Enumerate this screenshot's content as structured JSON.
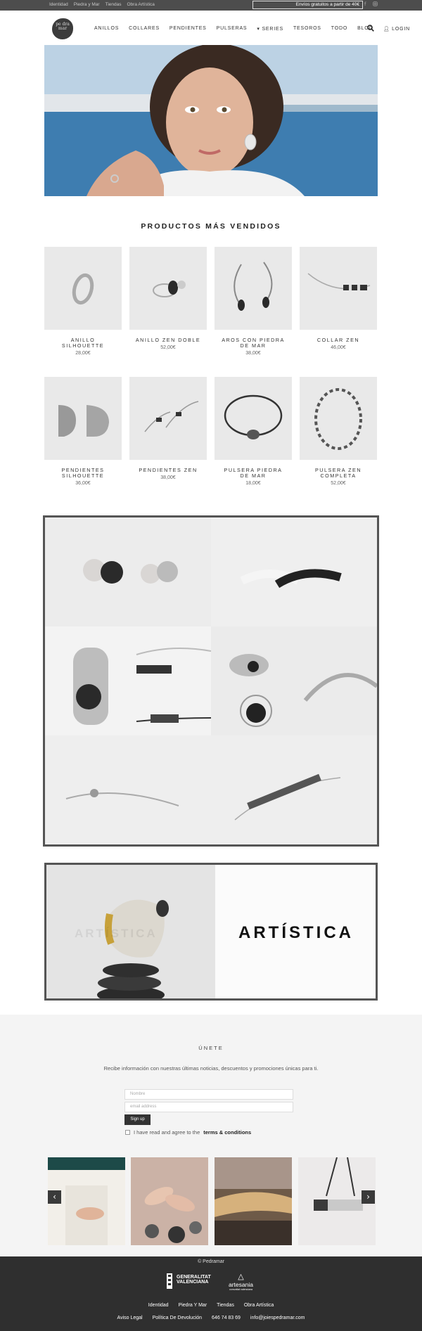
{
  "topbar": {
    "links": [
      "Identidad",
      "Piedra y Mar",
      "Tiendas",
      "Obra Artística"
    ],
    "shipping": "Envíos gratuitos a partir de 40€",
    "social": [
      "facebook-icon",
      "instagram-icon"
    ]
  },
  "header": {
    "logo_text": "pe dra mar",
    "nav": [
      "ANILLOS",
      "COLLARES",
      "PENDIENTES",
      "PULSERAS",
      "▾ SERIES",
      "TESOROS",
      "TODO",
      "BLOG",
      "LOGIN"
    ],
    "search_icon": "search-icon",
    "login_icon": "user-icon"
  },
  "bestsellers": {
    "title": "PRODUCTOS MÁS VENDIDOS",
    "products": [
      {
        "name": "ANILLO SILHOUETTE",
        "price": "28,00€"
      },
      {
        "name": "ANILLO ZEN DOBLE",
        "price": "52,00€"
      },
      {
        "name": "AROS CON PIEDRA DE MAR",
        "price": "38,00€"
      },
      {
        "name": "COLLAR ZEN",
        "price": "46,00€"
      },
      {
        "name": "PENDIENTES SILHOUETTE",
        "price": "36,00€"
      },
      {
        "name": "PENDIENTES ZEN",
        "price": "38,00€"
      },
      {
        "name": "PULSERA PIEDRA DE MAR",
        "price": "18,00€"
      },
      {
        "name": "PULSERA ZEN COMPLETA",
        "price": "52,00€"
      }
    ]
  },
  "obra": {
    "word": "ARTÍSTICA",
    "ghost": "ARTÍSTICA"
  },
  "newsletter": {
    "title": "ÚNETE",
    "description": "Recibe información con nuestras últimas noticias, descuentos y promociones únicas para ti.",
    "name_placeholder": "Nombre",
    "email_placeholder": "email address",
    "signup": "Sign up",
    "agree_prefix": "I have read and agree to the",
    "agree_link": "terms & conditions",
    "prev": "‹",
    "next": "›"
  },
  "footer": {
    "copyright": "© Pedramar",
    "gv_line1": "GENERALITAT",
    "gv_line2": "VALENCIANA",
    "artesania": "artesania",
    "artesania_sub": "comunitat valenciana",
    "links1": [
      "Identidad",
      "Piedra Y Mar",
      "Tiendas",
      "Obra Artística"
    ],
    "links2": [
      "Aviso Legal",
      "Política De Devolución",
      "646 74 83 69",
      "info@joiespedramar.com"
    ]
  },
  "colors": {
    "topbar": "#4d4d4d",
    "footer": "#2f2f2f",
    "newsletter_bg": "#f4f4f4",
    "frame": "#555555"
  }
}
